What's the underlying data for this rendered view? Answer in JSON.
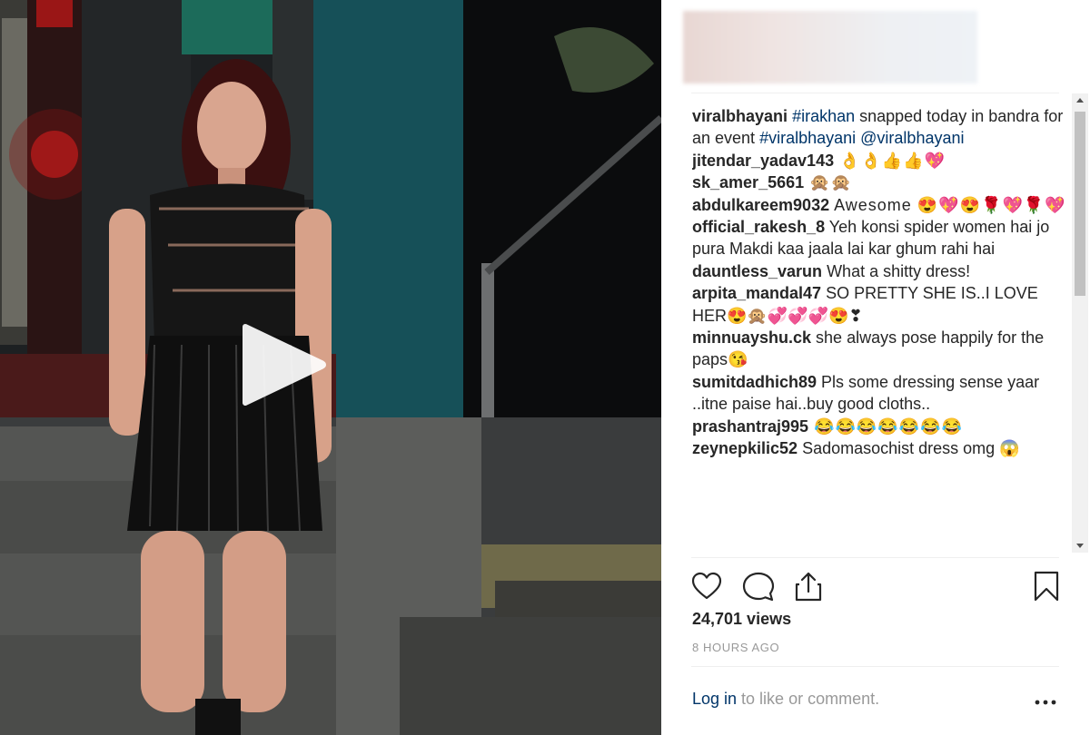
{
  "post": {
    "caption": {
      "user": "viralbhayani",
      "tag1": "#irakhan",
      "text1": " snapped today in bandra for an event ",
      "tag2": "#viralbhayani",
      "mention": "@viralbhayani"
    },
    "comments": [
      {
        "user": "jitendar_yadav143",
        "text": " 👌👌👍👍💖"
      },
      {
        "user": "sk_amer_5661",
        "text": " 🙊🙊"
      },
      {
        "user": "abdulkareem9032",
        "text": " Awesome 😍💖😍🌹💖🌹💖"
      },
      {
        "user": "official_rakesh_8",
        "text": " Yeh konsi spider women hai jo pura Makdi kaa jaala lai kar ghum rahi hai"
      },
      {
        "user": "dauntless_varun",
        "text": " What a shitty dress!"
      },
      {
        "user": "arpita_mandal47",
        "text": " SO PRETTY SHE IS..I LOVE HER😍🙊💞💞💞😍❣"
      },
      {
        "user": "minnuayshu.ck",
        "text": " she always pose happily for the paps😘"
      },
      {
        "user": "sumitdadhich89",
        "text": " Pls some dressing sense yaar ..itne paise hai..buy good cloths.."
      },
      {
        "user": "prashantraj995",
        "text": " 😂😂😂😂😂😂😂"
      },
      {
        "user": "zeynepkilic52",
        "text": " Sadomasochist dress omg 😱"
      }
    ],
    "views": "24,701 views",
    "time": "8 HOURS AGO",
    "login_link": "Log in",
    "login_rest": " to like or comment."
  },
  "icons": {
    "play": "play-icon",
    "like": "heart-icon",
    "comment": "speech-bubble-icon",
    "share": "share-icon",
    "save": "bookmark-icon",
    "more": "ellipsis-icon"
  },
  "colors": {
    "link": "#003569",
    "muted": "#999999",
    "text": "#262626"
  }
}
